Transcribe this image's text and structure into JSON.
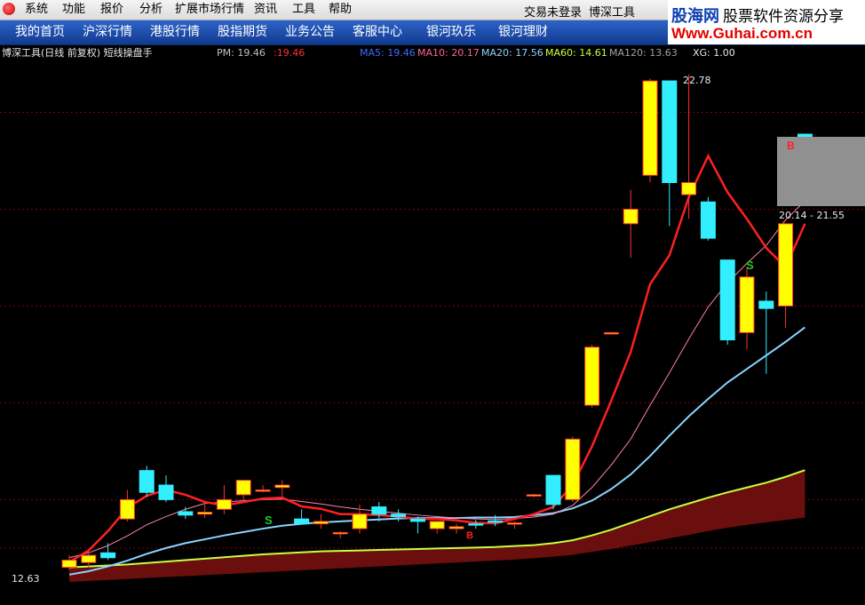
{
  "menu": {
    "items": [
      "系统",
      "功能",
      "报价",
      "分析",
      "扩展市场行情",
      "资讯",
      "工具",
      "帮助"
    ],
    "login_status": "交易未登录",
    "app_name": "博深工具"
  },
  "nav": {
    "tabs": [
      "我的首页",
      "沪深行情",
      "港股行情",
      "股指期货",
      "业务公告",
      "客服中心",
      "银河玖乐",
      "银河理财"
    ]
  },
  "brand": {
    "logo_main": "股海网",
    "logo_sub": "股票软件资源分享",
    "url": "Www.Guhai.com.cn"
  },
  "chart_header": {
    "title": "博深工具(日线 前复权) 短线操盘手",
    "pm_label": "PM: 19.46",
    "pm_value": ":19.46",
    "ma5": "MA5: 19.46",
    "ma10": "MA10: 20.17",
    "ma20": "MA20: 17.56",
    "ma60": "MA60: 14.61",
    "ma120": "MA120: 13.63",
    "xg": "XG: 1.00"
  },
  "annotations": {
    "high_label": "22.78",
    "low_label": "12.63",
    "range_label": "20.14 - 21.55",
    "buy_marker": "B",
    "sell_marker": "S",
    "small_b": "B"
  },
  "colors": {
    "up": "#ffff00",
    "down": "#33eeff",
    "ma5": "#ff2020",
    "ma10": "#ff80b0",
    "ma20": "#8ad4ff",
    "ma60": "#c8ff40",
    "band": "#6b0e0e",
    "grid": "#880000"
  },
  "chart_data": {
    "type": "candlestick",
    "candles": [
      {
        "o": 12.6,
        "h": 12.85,
        "l": 12.55,
        "c": 12.75
      },
      {
        "o": 12.7,
        "h": 12.95,
        "l": 12.6,
        "c": 12.85
      },
      {
        "o": 12.9,
        "h": 13.1,
        "l": 12.75,
        "c": 12.8
      },
      {
        "o": 13.6,
        "h": 14.2,
        "l": 13.55,
        "c": 14.0
      },
      {
        "o": 14.6,
        "h": 14.7,
        "l": 14.05,
        "c": 14.15
      },
      {
        "o": 14.3,
        "h": 14.5,
        "l": 13.95,
        "c": 14.0
      },
      {
        "o": 13.75,
        "h": 13.85,
        "l": 13.6,
        "c": 13.68
      },
      {
        "o": 13.7,
        "h": 13.9,
        "l": 13.62,
        "c": 13.74
      },
      {
        "o": 13.8,
        "h": 14.3,
        "l": 13.7,
        "c": 14.0
      },
      {
        "o": 14.1,
        "h": 14.4,
        "l": 13.95,
        "c": 14.4
      },
      {
        "o": 14.2,
        "h": 14.3,
        "l": 14.15,
        "c": 14.2
      },
      {
        "o": 14.25,
        "h": 14.4,
        "l": 14.0,
        "c": 14.3
      },
      {
        "o": 13.6,
        "h": 13.8,
        "l": 13.5,
        "c": 13.5
      },
      {
        "o": 13.5,
        "h": 13.7,
        "l": 13.4,
        "c": 13.55
      },
      {
        "o": 13.3,
        "h": 13.35,
        "l": 13.2,
        "c": 13.32
      },
      {
        "o": 13.4,
        "h": 13.9,
        "l": 13.3,
        "c": 13.7
      },
      {
        "o": 13.85,
        "h": 13.95,
        "l": 13.55,
        "c": 13.7
      },
      {
        "o": 13.7,
        "h": 13.8,
        "l": 13.55,
        "c": 13.65
      },
      {
        "o": 13.6,
        "h": 13.65,
        "l": 13.3,
        "c": 13.55
      },
      {
        "o": 13.4,
        "h": 13.55,
        "l": 13.3,
        "c": 13.55
      },
      {
        "o": 13.4,
        "h": 13.5,
        "l": 13.3,
        "c": 13.44
      },
      {
        "o": 13.5,
        "h": 13.58,
        "l": 13.4,
        "c": 13.48
      },
      {
        "o": 13.56,
        "h": 13.68,
        "l": 13.45,
        "c": 13.55
      },
      {
        "o": 13.5,
        "h": 13.55,
        "l": 13.4,
        "c": 13.52
      },
      {
        "o": 14.1,
        "h": 14.12,
        "l": 14.05,
        "c": 14.1
      },
      {
        "o": 14.5,
        "h": 14.5,
        "l": 13.8,
        "c": 13.9
      },
      {
        "o": 14.0,
        "h": 15.3,
        "l": 13.95,
        "c": 15.25
      },
      {
        "o": 15.95,
        "h": 17.2,
        "l": 15.9,
        "c": 17.15
      },
      {
        "o": 17.45,
        "h": 17.45,
        "l": 17.45,
        "c": 17.45
      },
      {
        "o": 19.7,
        "h": 20.4,
        "l": 19.0,
        "c": 20.0
      },
      {
        "o": 20.7,
        "h": 22.7,
        "l": 20.55,
        "c": 22.65
      },
      {
        "o": 22.65,
        "h": 22.65,
        "l": 19.65,
        "c": 20.55
      },
      {
        "o": 20.3,
        "h": 22.78,
        "l": 19.8,
        "c": 20.55
      },
      {
        "o": 20.15,
        "h": 20.25,
        "l": 19.35,
        "c": 19.4
      },
      {
        "o": 18.95,
        "h": 18.95,
        "l": 17.2,
        "c": 17.3
      },
      {
        "o": 17.45,
        "h": 18.8,
        "l": 17.1,
        "c": 18.6
      },
      {
        "o": 18.1,
        "h": 18.3,
        "l": 16.6,
        "c": 17.95
      },
      {
        "o": 18.0,
        "h": 19.7,
        "l": 17.55,
        "c": 19.7
      },
      {
        "o": 21.55,
        "h": 21.55,
        "l": 20.95,
        "c": 21.2
      }
    ],
    "ma5": [
      12.71,
      12.95,
      13.35,
      13.83,
      14.08,
      14.2,
      14.1,
      13.95,
      13.88,
      13.95,
      14.02,
      14.04,
      13.86,
      13.81,
      13.7,
      13.7,
      13.68,
      13.65,
      13.6,
      13.6,
      13.57,
      13.52,
      13.51,
      13.6,
      13.7,
      13.85,
      14.3,
      15.1,
      16.05,
      17.05,
      18.45,
      19.05,
      20.25,
      21.1,
      20.35,
      19.8,
      19.2,
      18.8,
      19.7
    ],
    "ma10": [
      12.8,
      12.9,
      13.05,
      13.25,
      13.48,
      13.65,
      13.8,
      13.92,
      13.95,
      13.98,
      14.0,
      14.01,
      13.96,
      13.91,
      13.85,
      13.8,
      13.76,
      13.72,
      13.68,
      13.65,
      13.62,
      13.6,
      13.59,
      13.61,
      13.64,
      13.7,
      13.88,
      14.25,
      14.72,
      15.25,
      15.95,
      16.62,
      17.32,
      17.98,
      18.48,
      18.88,
      19.25,
      19.78,
      20.17
    ],
    "ma20": [
      12.45,
      12.52,
      12.62,
      12.74,
      12.88,
      13.0,
      13.1,
      13.18,
      13.26,
      13.33,
      13.4,
      13.46,
      13.5,
      13.53,
      13.55,
      13.57,
      13.59,
      13.61,
      13.62,
      13.62,
      13.62,
      13.63,
      13.63,
      13.64,
      13.68,
      13.72,
      13.82,
      13.98,
      14.22,
      14.52,
      14.9,
      15.32,
      15.72,
      16.08,
      16.42,
      16.7,
      16.98,
      17.26,
      17.56
    ],
    "ma60": [
      12.6,
      12.62,
      12.64,
      12.66,
      12.69,
      12.72,
      12.75,
      12.78,
      12.81,
      12.84,
      12.87,
      12.89,
      12.91,
      12.93,
      12.94,
      12.95,
      12.96,
      12.97,
      12.98,
      12.99,
      13.0,
      13.01,
      13.02,
      13.04,
      13.06,
      13.1,
      13.16,
      13.26,
      13.38,
      13.52,
      13.66,
      13.8,
      13.92,
      14.04,
      14.15,
      14.25,
      14.35,
      14.47,
      14.61
    ],
    "ma120": [
      12.3,
      12.32,
      12.34,
      12.36,
      12.38,
      12.4,
      12.42,
      12.44,
      12.46,
      12.48,
      12.5,
      12.52,
      12.54,
      12.56,
      12.58,
      12.6,
      12.62,
      12.64,
      12.66,
      12.68,
      12.7,
      12.72,
      12.74,
      12.76,
      12.79,
      12.82,
      12.86,
      12.92,
      12.98,
      13.05,
      13.12,
      13.2,
      13.27,
      13.35,
      13.42,
      13.48,
      13.53,
      13.58,
      13.63
    ],
    "price_range": [
      12.3,
      22.9
    ],
    "dividers": [
      13.0,
      14.0,
      16.0,
      18.0,
      20.0,
      22.0
    ]
  }
}
